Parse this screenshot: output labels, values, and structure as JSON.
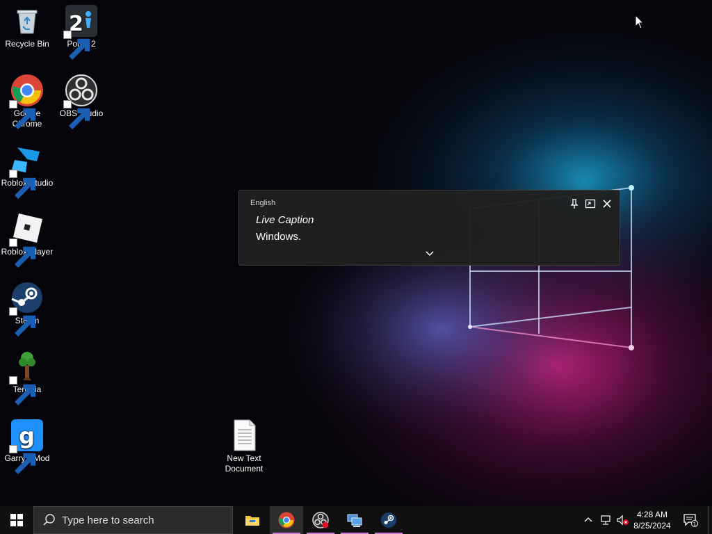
{
  "desktop": {
    "icons": [
      {
        "label": "Recycle Bin",
        "icon": "recycle-bin-icon"
      },
      {
        "label": "Portal 2",
        "icon": "portal-2-icon"
      },
      {
        "label": "Google Chrome",
        "icon": "chrome-icon"
      },
      {
        "label": "OBS Studio",
        "icon": "obs-icon"
      },
      {
        "label": "Roblox Studio",
        "icon": "roblox-studio-icon"
      },
      {
        "label": "Roblox Player",
        "icon": "roblox-player-icon"
      },
      {
        "label": "Steam",
        "icon": "steam-icon"
      },
      {
        "label": "Terraria",
        "icon": "terraria-icon"
      },
      {
        "label": "Garry's Mod",
        "icon": "garrys-mod-icon"
      },
      {
        "label": "New Text Document",
        "icon": "text-document-icon"
      }
    ]
  },
  "live_caption": {
    "language": "English",
    "title": "Live Caption",
    "text": "Windows."
  },
  "taskbar": {
    "search_placeholder": "Type here to search",
    "apps": [
      "file-explorer-icon",
      "chrome-icon",
      "obs-icon",
      "network-app-icon",
      "steam-icon"
    ],
    "active_app": "chrome-icon",
    "tray": {
      "time": "4:28 AM",
      "date": "8/25/2024",
      "notification_count": "1"
    }
  },
  "colors": {
    "taskbar": "#101010",
    "search_bg": "#2b2b2b",
    "active_underline": "#c97fd6",
    "caption_bg": "#202020"
  }
}
